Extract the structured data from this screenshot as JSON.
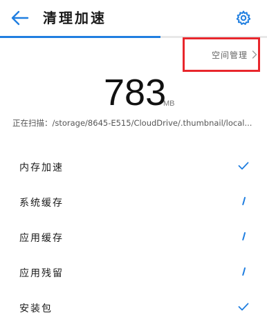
{
  "header": {
    "title": "清理加速",
    "back_icon": "arrow-left-icon",
    "settings_icon": "gear-icon"
  },
  "progress": {
    "fraction": 0.6,
    "color": "#1f7ee0"
  },
  "space_management": {
    "label": "空间管理",
    "icon": "chevron-right-icon",
    "highlight_color": "#e8262c"
  },
  "summary": {
    "size_value": "783",
    "size_unit": "MB",
    "scan_text": "正在扫描：/storage/8645-E515/CloudDrive/.thumbnail/local..."
  },
  "items": [
    {
      "label": "内存加速",
      "status": "done"
    },
    {
      "label": "系统缓存",
      "status": "scanning"
    },
    {
      "label": "应用缓存",
      "status": "scanning"
    },
    {
      "label": "应用残留",
      "status": "scanning"
    },
    {
      "label": "安装包",
      "status": "done"
    }
  ],
  "colors": {
    "accent": "#1f7ee0",
    "highlight": "#e8262c"
  }
}
